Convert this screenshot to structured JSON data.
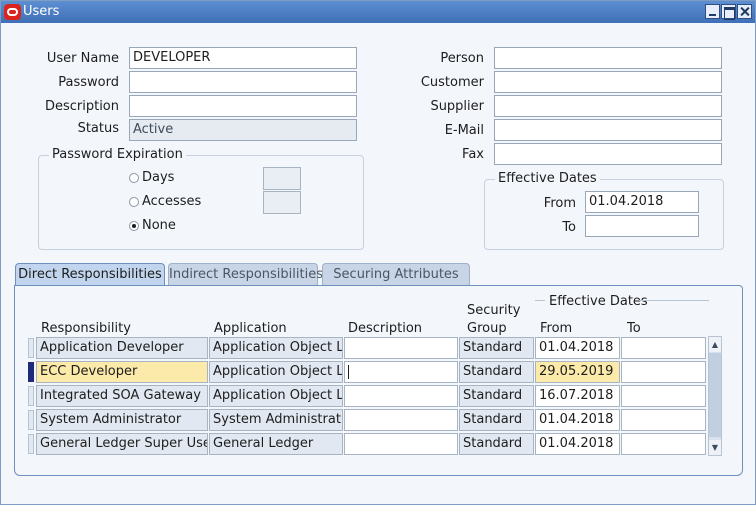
{
  "window": {
    "title": "Users"
  },
  "user_form": {
    "user_name_label": "User Name",
    "user_name_value": "DEVELOPER",
    "password_label": "Password",
    "password_value": "",
    "description_label": "Description",
    "description_value": "",
    "status_label": "Status",
    "status_value": "Active",
    "person_label": "Person",
    "person_value": "",
    "customer_label": "Customer",
    "customer_value": "",
    "supplier_label": "Supplier",
    "supplier_value": "",
    "email_label": "E-Mail",
    "email_value": "",
    "fax_label": "Fax",
    "fax_value": ""
  },
  "password_expiration": {
    "title": "Password Expiration",
    "options": [
      {
        "label": "Days",
        "selected": false
      },
      {
        "label": "Accesses",
        "selected": false
      },
      {
        "label": "None",
        "selected": true
      }
    ]
  },
  "effective_dates": {
    "title": "Effective Dates",
    "from_label": "From",
    "from_value": "01.04.2018",
    "to_label": "To",
    "to_value": ""
  },
  "tabs": [
    {
      "label": "Direct Responsibilities",
      "active": true
    },
    {
      "label": "Indirect Responsibilities",
      "active": false
    },
    {
      "label": "Securing Attributes",
      "active": false
    }
  ],
  "responsibilities": {
    "columns": {
      "responsibility": "Responsibility",
      "application": "Application",
      "description": "Description",
      "security_group_line1": "Security",
      "security_group_line2": "Group",
      "effective_dates": "Effective Dates",
      "from": "From",
      "to": "To"
    },
    "rows": [
      {
        "responsibility": "Application Developer",
        "application": "Application Object Libr",
        "description": "",
        "security_group": "Standard",
        "from": "01.04.2018",
        "to": ""
      },
      {
        "responsibility": "ECC Developer",
        "application": "Application Object Libr",
        "description": "",
        "security_group": "Standard",
        "from": "29.05.2019",
        "to": ""
      },
      {
        "responsibility": "Integrated SOA Gateway",
        "application": "Application Object Libr",
        "description": "",
        "security_group": "Standard",
        "from": "16.07.2018",
        "to": ""
      },
      {
        "responsibility": "System Administrator",
        "application": "System Administration",
        "description": "",
        "security_group": "Standard",
        "from": "01.04.2018",
        "to": ""
      },
      {
        "responsibility": "General Ledger Super User",
        "application": "General Ledger",
        "description": "",
        "security_group": "Standard",
        "from": "01.04.2018",
        "to": ""
      }
    ],
    "current_row": 1
  },
  "icons": {
    "logo": "oracle-logo-icon",
    "minimize": "minimize-icon",
    "maximize": "maximize-icon",
    "close": "close-icon"
  },
  "colors": {
    "titlebar": "#3f6fb6",
    "current_row_field": "#fbeaa9",
    "current_row_marker": "#1f2b7a"
  }
}
